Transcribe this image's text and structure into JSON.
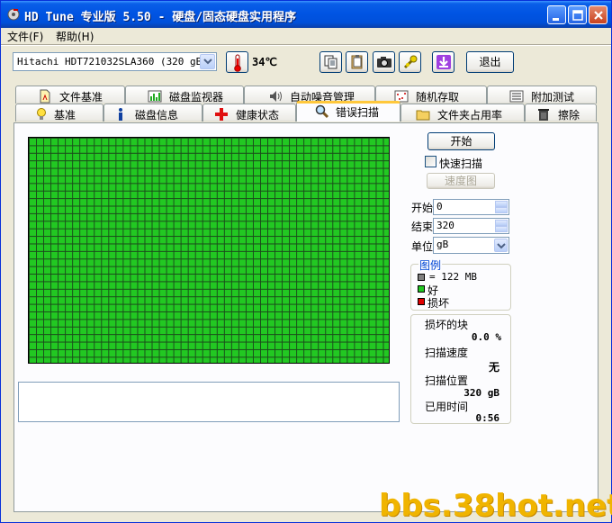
{
  "window": {
    "title": "HD Tune 专业版 5.50 - 硬盘/固态硬盘实用程序"
  },
  "menu": {
    "file": "文件(F)",
    "help": "帮助(H)"
  },
  "toolbar": {
    "drive": "Hitachi HDT721032SLA360 (320 gB)",
    "temperature": "34℃",
    "exit_label": "退出"
  },
  "tabs_row1": [
    {
      "label": "文件基准",
      "icon": "file-benchmark-icon"
    },
    {
      "label": "磁盘监视器",
      "icon": "disk-monitor-icon"
    },
    {
      "label": "自动噪音管理",
      "icon": "speaker-icon"
    },
    {
      "label": "随机存取",
      "icon": "random-access-icon"
    },
    {
      "label": "附加测试",
      "icon": "extra-tests-icon"
    }
  ],
  "tabs_row2": [
    {
      "label": "基准",
      "icon": "lightbulb-icon"
    },
    {
      "label": "磁盘信息",
      "icon": "info-icon"
    },
    {
      "label": "健康状态",
      "icon": "health-cross-icon"
    },
    {
      "label": "错误扫描",
      "icon": "magnifier-icon",
      "active": true
    },
    {
      "label": "文件夹占用率",
      "icon": "folder-icon"
    },
    {
      "label": "擦除",
      "icon": "trash-icon"
    }
  ],
  "scan": {
    "start_button": "开始",
    "quick_scan_label": "快速扫描",
    "quick_scan_checked": false,
    "speed_map_button": "速度图",
    "start_label": "开始",
    "start_value": "0",
    "end_label": "结束",
    "end_value": "320",
    "unit_label": "单位",
    "unit_value": "gB"
  },
  "legend": {
    "title": "图例",
    "block_size": "= 122 MB",
    "good": "好",
    "bad": "损坏",
    "colors": {
      "good": "#22C822",
      "bad": "#E00000",
      "block": "#808080"
    }
  },
  "stats": {
    "damaged_blocks_label": "损坏的块",
    "damaged_blocks_value": "0.0 %",
    "scan_speed_label": "扫描速度",
    "scan_speed_value": "无",
    "scan_position_label": "扫描位置",
    "scan_position_value": "320 gB",
    "elapsed_label": "已用时间",
    "elapsed_value": "0:56"
  },
  "watermark": "bbs.38hot.net"
}
